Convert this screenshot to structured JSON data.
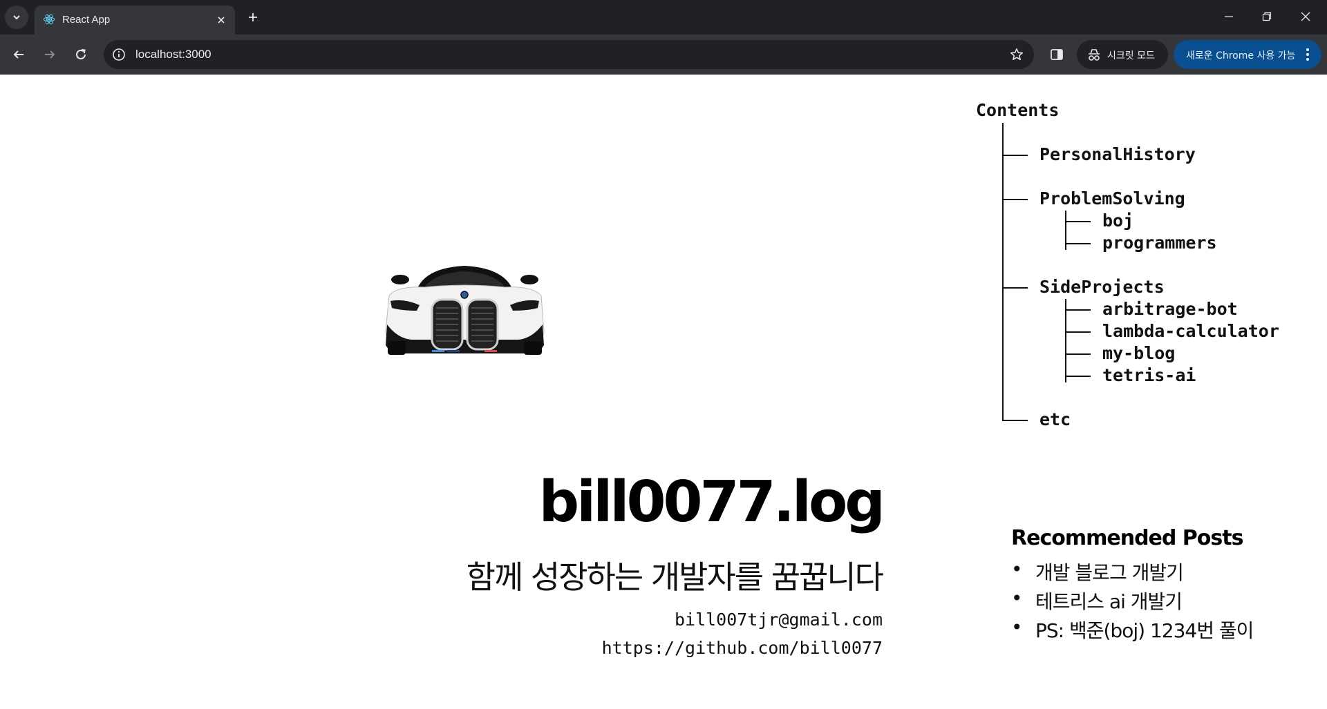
{
  "browser": {
    "tab_title": "React App",
    "url": "localhost:3000",
    "incognito_label": "시크릿 모드",
    "update_label": "새로운 Chrome 사용 가능",
    "accent_color": "#0a4f8f"
  },
  "contents": {
    "title": "Contents",
    "sections": {
      "personal_history": "PersonalHistory",
      "problem_solving": "ProblemSolving",
      "boj": "boj",
      "programmers": "programmers",
      "side_projects": "SideProjects",
      "arbitrage_bot": "arbitrage-bot",
      "lambda_calculator": "lambda-calculator",
      "my_blog": "my-blog",
      "tetris_ai": "tetris-ai",
      "etc": "etc"
    }
  },
  "hero": {
    "title": "bill0077.log",
    "subtitle": "함께 성장하는 개발자를 꿈꿉니다",
    "email": "bill007tjr@gmail.com",
    "github": "https://github.com/bill0077"
  },
  "recommended": {
    "title": "Recommended Posts",
    "bullet": "•",
    "posts": [
      "개발 블로그 개발기",
      "테트리스 ai 개발기",
      "PS: 백준(boj) 1234번 풀이"
    ]
  }
}
